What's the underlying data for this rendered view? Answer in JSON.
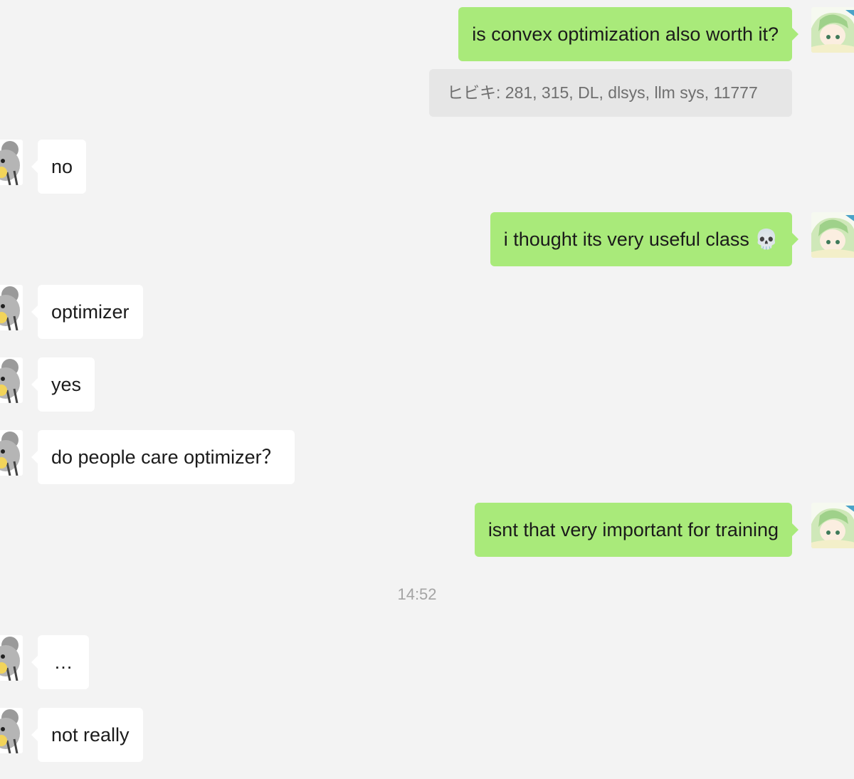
{
  "chat": {
    "messages": [
      {
        "sender": "me",
        "text": "is convex optimization also worth it?"
      },
      {
        "sender": "me",
        "type": "quote",
        "text": "ヒビキ: 281, 315, DL, dlsys, llm sys, 11777"
      },
      {
        "sender": "them",
        "text": "no"
      },
      {
        "sender": "me",
        "text": "i thought its very useful class 💀"
      },
      {
        "sender": "them",
        "text": "optimizer"
      },
      {
        "sender": "them",
        "text": "yes"
      },
      {
        "sender": "them",
        "text": "do people care optimizer？"
      },
      {
        "sender": "me",
        "text": "isnt that very important for training"
      },
      {
        "type": "timestamp",
        "text": "14:52"
      },
      {
        "sender": "them",
        "text": "…"
      },
      {
        "sender": "them",
        "text": "not really"
      }
    ]
  },
  "colors": {
    "background": "#f3f3f3",
    "outgoing_bubble": "#a9ea7a",
    "incoming_bubble": "#ffffff",
    "quote_background": "#e6e6e6",
    "quote_text": "#6f6f6f",
    "timestamp_text": "#a4a4a4"
  },
  "avatars": {
    "me": "anime-girl-avatar",
    "them": "koala-avatar"
  }
}
